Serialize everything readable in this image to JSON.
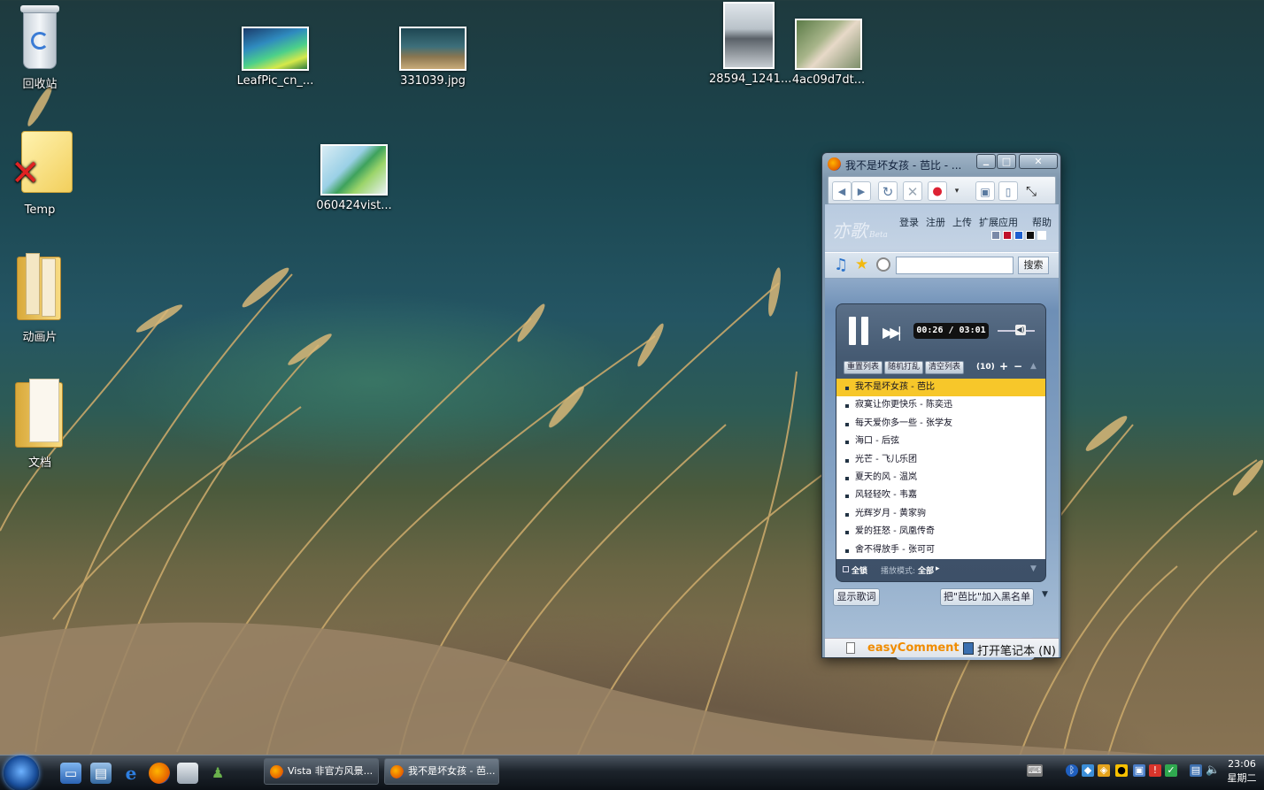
{
  "desktop": {
    "icons": [
      {
        "label": "回收站"
      },
      {
        "label": "Temp"
      },
      {
        "label": "动画片"
      },
      {
        "label": "文档"
      },
      {
        "label": "LeafPic_cn_..."
      },
      {
        "label": "331039.jpg"
      },
      {
        "label": "060424vist..."
      },
      {
        "label": "28594_1241..."
      },
      {
        "label": "4ac09d7dt..."
      }
    ]
  },
  "window": {
    "title": "我不是坏女孩 - 芭比 - ...",
    "controls": {
      "minimize": "▁",
      "maximize": "□",
      "close": "✕"
    },
    "nav": {
      "back": "◀",
      "forward": "▶",
      "reload": "↻",
      "stop": "✕"
    },
    "site": {
      "logo": "亦歌",
      "logo_beta": "Beta",
      "menu": [
        "登录",
        "注册",
        "上传",
        "扩展应用",
        "帮助"
      ],
      "theme_colors": [
        "#7a8aa8",
        "#c0102a",
        "#1c5fd0",
        "#111111",
        "#ffffff"
      ],
      "search_placeholder": "",
      "search_button": "搜索"
    },
    "player": {
      "time": "00:26 / 03:01",
      "list_buttons": [
        "重置列表",
        "随机打乱",
        "清空列表"
      ],
      "count": "(10)",
      "plus": "+",
      "minus": "−",
      "songs": [
        "我不是坏女孩 - 芭比",
        "寂寞让你更快乐 - 陈奕迅",
        "每天爱你多一些 - 张学友",
        "海口 - 后弦",
        "光芒 - 飞儿乐团",
        "夏天的风 - 温岚",
        "风轻轻吹 - 韦嘉",
        "光辉岁月 - 黄家驹",
        "爱的狂怒 - 凤凰传奇",
        "舍不得放手 - 张可可"
      ],
      "selected_index": 0,
      "lock_label": "全锁",
      "mode_label": "播放模式:",
      "mode_value": "全部"
    },
    "show_lyrics": "显示歌词",
    "blacklist": "把\"芭比\"加入黑名单",
    "status": {
      "easycomment": "easyComment",
      "notebook": "打开笔记本 (N)"
    }
  },
  "taskbar": {
    "buttons": [
      {
        "label": "Vista 非官方风景..."
      },
      {
        "label": "我不是坏女孩 - 芭..."
      }
    ],
    "clock": {
      "time": "23:06",
      "day": "星期二"
    }
  }
}
